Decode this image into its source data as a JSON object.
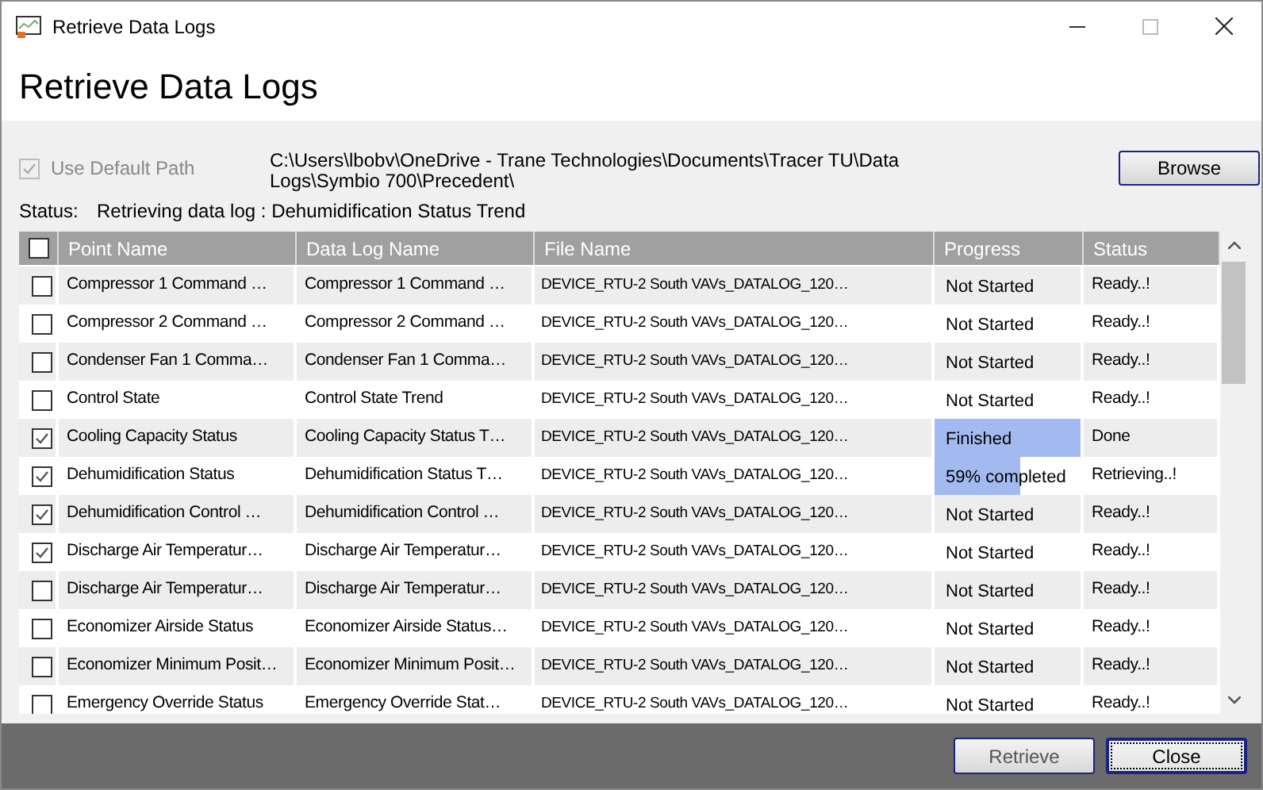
{
  "window": {
    "title": "Retrieve Data Logs"
  },
  "heading": "Retrieve Data Logs",
  "use_default_path": {
    "label": "Use Default Path",
    "checked": true,
    "disabled": true
  },
  "path": "C:\\Users\\lbobv\\OneDrive - Trane Technologies\\Documents\\Tracer TU\\Data Logs\\Symbio 700\\Precedent\\",
  "browse_button": "Browse",
  "status": {
    "label": "Status:",
    "value": "Retrieving data log : Dehumidification Status Trend"
  },
  "table": {
    "select_all": {
      "checked": false
    },
    "columns": [
      "Point Name",
      "Data Log Name",
      "File Name",
      "Progress",
      "Status"
    ],
    "rows": [
      {
        "checked": false,
        "point": "Compressor 1 Command …",
        "log": "Compressor 1 Command …",
        "file": "DEVICE_RTU-2 South VAVs_DATALOG_120…",
        "progress": "Not Started",
        "level": 0,
        "status": "Ready..!"
      },
      {
        "checked": false,
        "point": "Compressor 2 Command …",
        "log": "Compressor 2 Command …",
        "file": "DEVICE_RTU-2 South VAVs_DATALOG_120…",
        "progress": "Not Started",
        "level": 0,
        "status": "Ready..!"
      },
      {
        "checked": false,
        "point": "Condenser Fan 1 Comma…",
        "log": "Condenser Fan 1 Comma…",
        "file": "DEVICE_RTU-2 South VAVs_DATALOG_120…",
        "progress": "Not Started",
        "level": 0,
        "status": "Ready..!"
      },
      {
        "checked": false,
        "point": "Control State",
        "log": "Control State Trend",
        "file": "DEVICE_RTU-2 South VAVs_DATALOG_120…",
        "progress": "Not Started",
        "level": 0,
        "status": "Ready..!"
      },
      {
        "checked": true,
        "point": "Cooling Capacity Status",
        "log": "Cooling Capacity Status T…",
        "file": "DEVICE_RTU-2 South VAVs_DATALOG_120…",
        "progress": "Finished",
        "level": 1,
        "status": "Done"
      },
      {
        "checked": true,
        "point": "Dehumidification Status",
        "log": "Dehumidification Status T…",
        "file": "DEVICE_RTU-2 South VAVs_DATALOG_120…",
        "progress": "59% completed",
        "level": 0.59,
        "status": "Retrieving..!"
      },
      {
        "checked": true,
        "point": "Dehumidification Control …",
        "log": "Dehumidification Control …",
        "file": "DEVICE_RTU-2 South VAVs_DATALOG_120…",
        "progress": "Not Started",
        "level": 0,
        "status": "Ready..!"
      },
      {
        "checked": true,
        "point": "Discharge Air Temperatur…",
        "log": "Discharge Air Temperatur…",
        "file": "DEVICE_RTU-2 South VAVs_DATALOG_120…",
        "progress": "Not Started",
        "level": 0,
        "status": "Ready..!"
      },
      {
        "checked": false,
        "point": "Discharge Air Temperatur…",
        "log": "Discharge Air Temperatur…",
        "file": "DEVICE_RTU-2 South VAVs_DATALOG_120…",
        "progress": "Not Started",
        "level": 0,
        "status": "Ready..!"
      },
      {
        "checked": false,
        "point": "Economizer Airside Status",
        "log": "Economizer Airside Status…",
        "file": "DEVICE_RTU-2 South VAVs_DATALOG_120…",
        "progress": "Not Started",
        "level": 0,
        "status": "Ready..!"
      },
      {
        "checked": false,
        "point": "Economizer Minimum Posit…",
        "log": "Economizer Minimum Posit…",
        "file": "DEVICE_RTU-2 South VAVs_DATALOG_120…",
        "progress": "Not Started",
        "level": 0,
        "status": "Ready..!"
      },
      {
        "checked": false,
        "point": "Emergency Override Status",
        "log": "Emergency Override Stat…",
        "file": "DEVICE_RTU-2 South VAVs_DATALOG_120…",
        "progress": "Not Started",
        "level": 0,
        "status": "Ready..!"
      }
    ]
  },
  "buttons": [
    "Retrieve",
    "Close"
  ]
}
